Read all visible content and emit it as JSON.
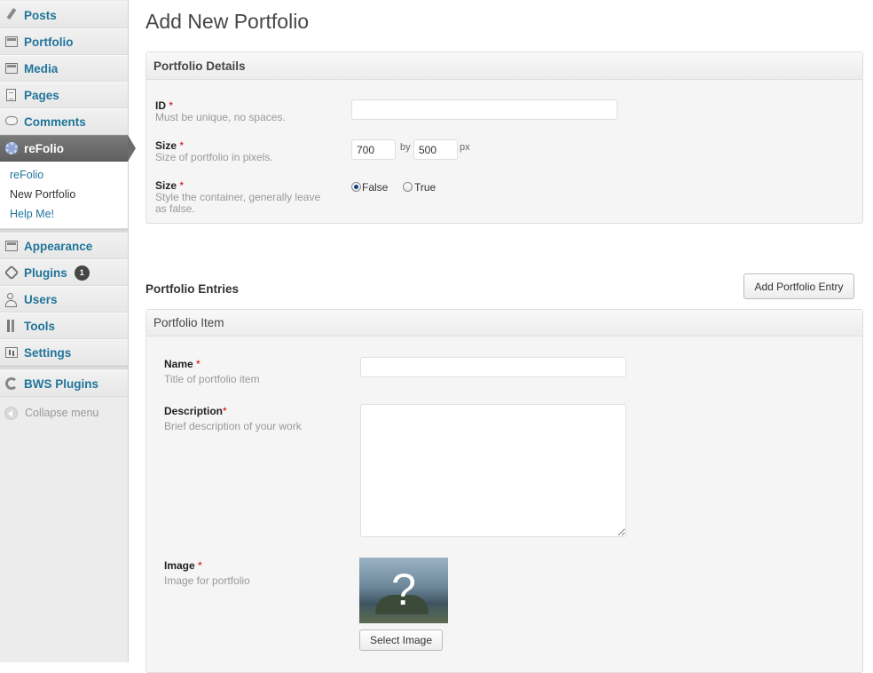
{
  "sidebar": {
    "items": [
      {
        "label": "Posts",
        "icon": "pushpin-icon"
      },
      {
        "label": "Portfolio",
        "icon": "portfolio-icon"
      },
      {
        "label": "Media",
        "icon": "media-icon"
      },
      {
        "label": "Pages",
        "icon": "pages-icon"
      },
      {
        "label": "Comments",
        "icon": "comments-icon"
      },
      {
        "label": "reFolio",
        "icon": "gear-icon",
        "active": true
      }
    ],
    "submenu": [
      {
        "label": "reFolio"
      },
      {
        "label": "New Portfolio",
        "current": true
      },
      {
        "label": "Help Me!"
      }
    ],
    "items2": [
      {
        "label": "Appearance",
        "icon": "appearance-icon"
      },
      {
        "label": "Plugins",
        "icon": "plugins-icon",
        "badge": "1"
      },
      {
        "label": "Users",
        "icon": "users-icon"
      },
      {
        "label": "Tools",
        "icon": "tools-icon"
      },
      {
        "label": "Settings",
        "icon": "settings-icon"
      }
    ],
    "bws": {
      "label": "BWS Plugins",
      "icon": "bws-icon"
    },
    "collapse_label": "Collapse menu"
  },
  "page": {
    "title": "Add New Portfolio"
  },
  "details": {
    "title": "Portfolio Details",
    "id_field": {
      "label": "ID",
      "required": "*",
      "desc": "Must be unique, no spaces.",
      "value": ""
    },
    "size_field": {
      "label": "Size",
      "required": "*",
      "desc": "Size of portfolio in pixels.",
      "width": "700",
      "by": "by",
      "height": "500",
      "unit": "px"
    },
    "style_field": {
      "label": "Size",
      "required": "*",
      "desc_line1": "Style the container, generally leave",
      "desc_line2": "as false.",
      "options": [
        "False",
        "True"
      ],
      "selected": "False"
    }
  },
  "entries": {
    "title": "Portfolio Entries",
    "add_button": "Add Portfolio Entry",
    "item": {
      "title": "Portfolio Item",
      "name_field": {
        "label": "Name",
        "required": "*",
        "desc": "Title of portfolio item",
        "value": ""
      },
      "description_field": {
        "label": "Description",
        "required": "*",
        "desc": "Brief description of your work",
        "value": ""
      },
      "image_field": {
        "label": "Image",
        "required": "*",
        "desc": "Image for portfolio",
        "placeholder_glyph": "?",
        "button": "Select Image"
      }
    }
  },
  "colors": {
    "link": "#21759b",
    "active_bg": "#6c6c6c",
    "required": "#cc0000",
    "badge_bg": "#464646"
  }
}
